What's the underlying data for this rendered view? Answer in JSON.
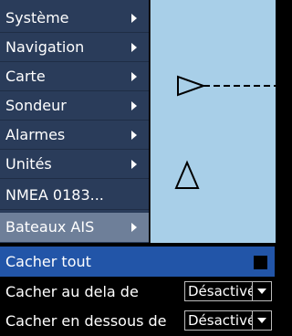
{
  "menu": {
    "items": [
      {
        "label": "Système",
        "has_submenu": true,
        "selected": false
      },
      {
        "label": "Navigation",
        "has_submenu": true,
        "selected": false
      },
      {
        "label": "Carte",
        "has_submenu": true,
        "selected": false
      },
      {
        "label": "Sondeur",
        "has_submenu": true,
        "selected": false
      },
      {
        "label": "Alarmes",
        "has_submenu": true,
        "selected": false
      },
      {
        "label": "Unités",
        "has_submenu": true,
        "selected": false
      },
      {
        "label": "NMEA 0183...",
        "has_submenu": false,
        "selected": false
      },
      {
        "label": "Bateaux AIS",
        "has_submenu": true,
        "selected": true
      }
    ]
  },
  "submenu": {
    "hide_all": {
      "label": "Cacher tout",
      "checked": false
    },
    "hide_beyond": {
      "label": "Cacher au dela de",
      "value": "Désactivé"
    },
    "hide_below": {
      "label": "Cacher en dessous de",
      "value": "Désactivé"
    }
  },
  "colors": {
    "menu_bg": "#2a3c5a",
    "menu_selected": "#6e7f99",
    "chart_water": "#a8cfe8",
    "highlight_row": "#2255a8"
  }
}
